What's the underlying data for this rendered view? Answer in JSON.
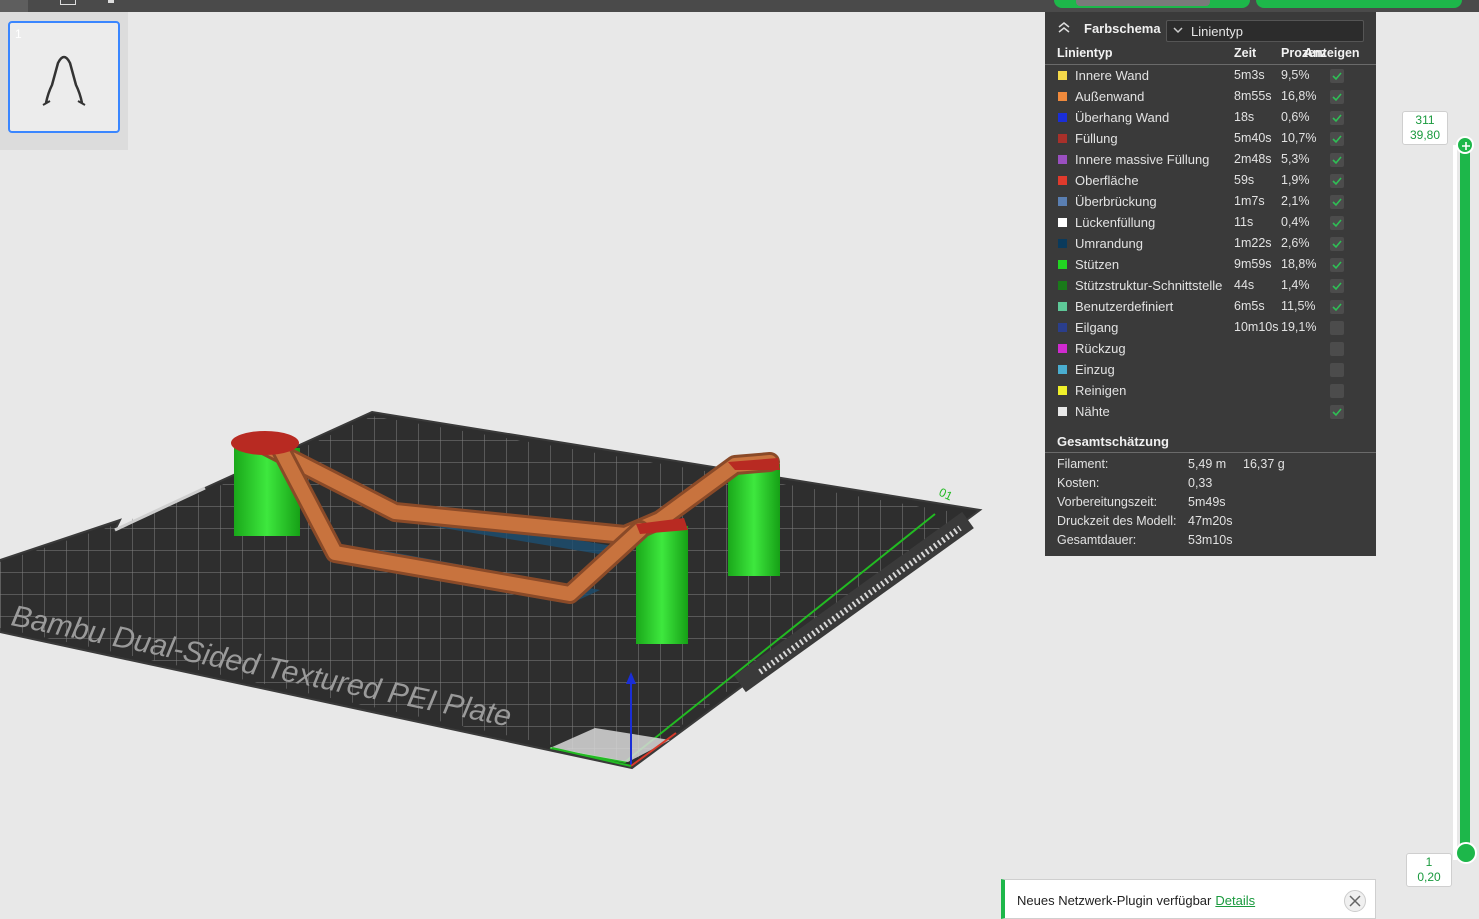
{
  "plate": {
    "number": "1"
  },
  "legend": {
    "scheme_label": "Farbschema",
    "scheme_value": "Linientyp",
    "headers": {
      "type": "Linientyp",
      "time": "Zeit",
      "percent": "Prozent",
      "show": "Anzeigen"
    },
    "rows": [
      {
        "name": "Innere Wand",
        "time": "5m3s",
        "percent": "9,5%",
        "color": "#f5d94a",
        "checked": true
      },
      {
        "name": "Außenwand",
        "time": "8m55s",
        "percent": "16,8%",
        "color": "#f08a3c",
        "checked": true
      },
      {
        "name": "Überhang Wand",
        "time": "18s",
        "percent": "0,6%",
        "color": "#1a2ed8",
        "checked": true
      },
      {
        "name": "Füllung",
        "time": "5m40s",
        "percent": "10,7%",
        "color": "#a8302a",
        "checked": true
      },
      {
        "name": "Innere massive Füllung",
        "time": "2m48s",
        "percent": "5,3%",
        "color": "#9a4fc0",
        "checked": true
      },
      {
        "name": "Oberfläche",
        "time": "59s",
        "percent": "1,9%",
        "color": "#e03a2c",
        "checked": true
      },
      {
        "name": "Überbrückung",
        "time": "1m7s",
        "percent": "2,1%",
        "color": "#5a7fb2",
        "checked": true
      },
      {
        "name": "Lückenfüllung",
        "time": "11s",
        "percent": "0,4%",
        "color": "#ffffff",
        "checked": true
      },
      {
        "name": "Umrandung",
        "time": "1m22s",
        "percent": "2,6%",
        "color": "#0a3a5c",
        "checked": true
      },
      {
        "name": "Stützen",
        "time": "9m59s",
        "percent": "18,8%",
        "color": "#22d422",
        "checked": true
      },
      {
        "name": "Stützstruktur-Schnittstelle",
        "time": "44s",
        "percent": "1,4%",
        "color": "#1a7a1a",
        "checked": true
      },
      {
        "name": "Benutzerdefiniert",
        "time": "6m5s",
        "percent": "11,5%",
        "color": "#5ec898",
        "checked": true
      },
      {
        "name": "Eilgang",
        "time": "10m10s",
        "percent": "19,1%",
        "color": "#2a3e8c",
        "checked": false
      },
      {
        "name": "Rückzug",
        "time": "",
        "percent": "",
        "color": "#d02ad0",
        "checked": false
      },
      {
        "name": "Einzug",
        "time": "",
        "percent": "",
        "color": "#4aaed0",
        "checked": false
      },
      {
        "name": "Reinigen",
        "time": "",
        "percent": "",
        "color": "#f0f02a",
        "checked": false
      },
      {
        "name": "Nähte",
        "time": "",
        "percent": "",
        "color": "#e8e8e8",
        "checked": true
      }
    ],
    "estimate": {
      "title": "Gesamtschätzung",
      "rows": [
        {
          "key": "Filament:",
          "value": "5,49 m",
          "value2": "16,37 g"
        },
        {
          "key": "Kosten:",
          "value": "0,33",
          "value2": ""
        },
        {
          "key": "Vorbereitungszeit:",
          "value": "5m49s",
          "value2": ""
        },
        {
          "key": "Druckzeit des Modell:",
          "value": "47m20s",
          "value2": ""
        },
        {
          "key": "Gesamtdauer:",
          "value": "53m10s",
          "value2": ""
        }
      ]
    }
  },
  "slider": {
    "top_layer": "311",
    "top_height": "39,80",
    "bottom_layer": "1",
    "bottom_height": "0,20"
  },
  "bed": {
    "label": "Bambu Dual-Sided Textured PEI Plate",
    "corner_mark": "01"
  },
  "notification": {
    "text": "Neues Netzwerk-Plugin verfügbar",
    "link": "Details"
  }
}
